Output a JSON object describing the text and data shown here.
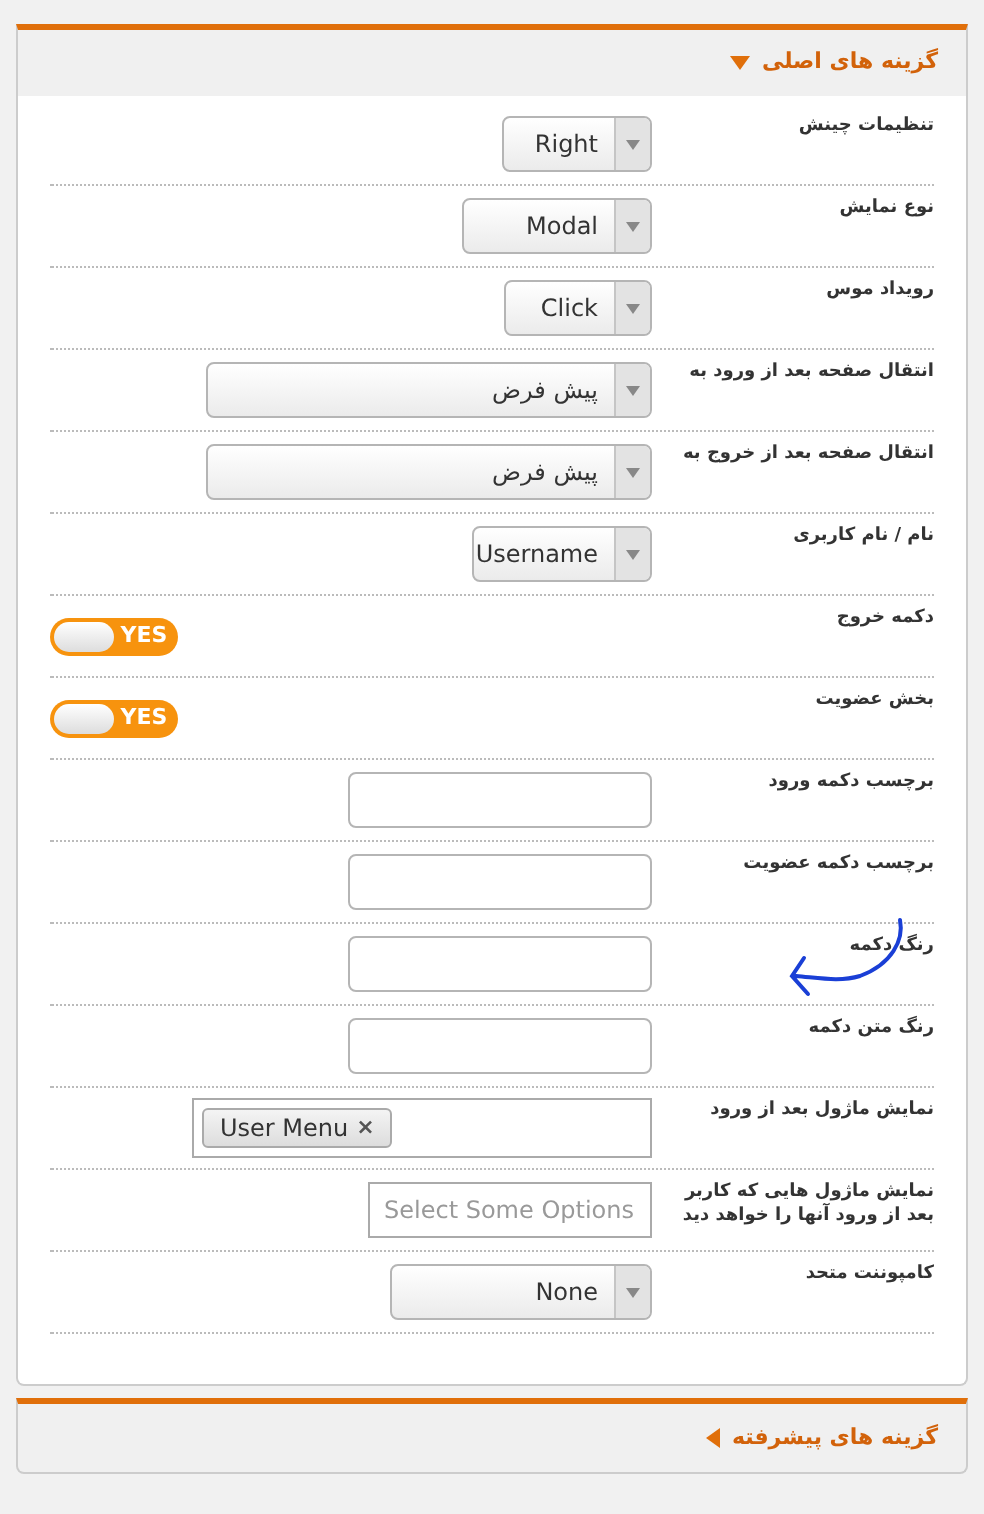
{
  "main_section": {
    "title": "گزینه های اصلی",
    "expanded": true
  },
  "rows": [
    {
      "kind": "select",
      "label": "تنظیمات چینش",
      "value": "Right"
    },
    {
      "kind": "select",
      "label": "نوع نمایش",
      "value": "Modal"
    },
    {
      "kind": "select",
      "label": "رویداد موس",
      "value": "Click"
    },
    {
      "kind": "select",
      "label": "انتقال صفحه بعد از ورود به",
      "value": "پیش فرض"
    },
    {
      "kind": "select",
      "label": "انتقال صفحه بعد از خروج به",
      "value": "پیش فرض"
    },
    {
      "kind": "select",
      "label": "نام / نام کاربری",
      "value": "Username"
    },
    {
      "kind": "toggle",
      "label": "دکمه خروج",
      "on": true,
      "text": "YES"
    },
    {
      "kind": "toggle",
      "label": "بخش عضویت",
      "on": true,
      "text": "YES"
    },
    {
      "kind": "text",
      "label": "برچسب دکمه ورود"
    },
    {
      "kind": "text",
      "label": "برچسب دکمه عضویت"
    },
    {
      "kind": "text",
      "label": "رنگ دکمه"
    },
    {
      "kind": "text",
      "label": "رنگ متن دکمه"
    },
    {
      "kind": "tags",
      "label": "نمایش ماژول بعد از ورود",
      "tags": [
        "User Menu"
      ],
      "remove": "×"
    },
    {
      "kind": "multiselect",
      "label": "نمایش ماژول هایی که کاربر بعد از ورود آنها را خواهد دید",
      "placeholder": "Select Some Options"
    },
    {
      "kind": "select",
      "label": "کامپوننت متحد",
      "value": "None"
    }
  ],
  "advanced_section": {
    "title": "گزینه های پیشرفته",
    "expanded": false
  }
}
